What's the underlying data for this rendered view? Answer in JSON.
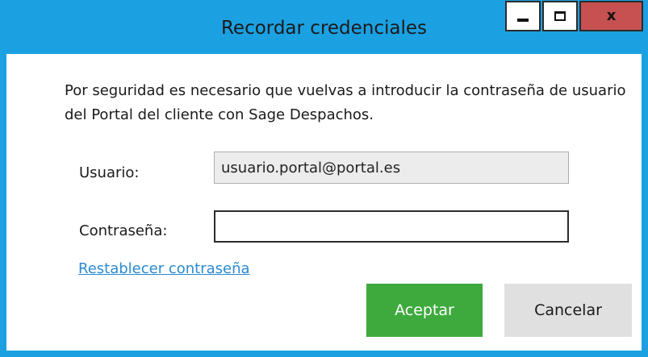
{
  "window": {
    "title": "Recordar credenciales",
    "controls": {
      "minimize_icon": "minimize-icon",
      "maximize_icon": "maximize-icon",
      "close_icon": "close-icon",
      "close_glyph": "x"
    }
  },
  "dialog": {
    "message": "Por seguridad es necesario que vuelvas a introducir la contraseña de usuario del Portal del cliente con Sage Despachos.",
    "user_label": "Usuario:",
    "user_value": "usuario.portal@portal.es",
    "password_label": "Contraseña:",
    "password_value": "",
    "reset_link": "Restablecer contraseña",
    "accept_label": "Aceptar",
    "cancel_label": "Cancelar"
  },
  "colors": {
    "frame": "#1ba1e2",
    "close_button": "#c75050",
    "accept_button": "#3eaa3e",
    "cancel_button": "#e0e0e0",
    "link": "#2a8ad1"
  }
}
